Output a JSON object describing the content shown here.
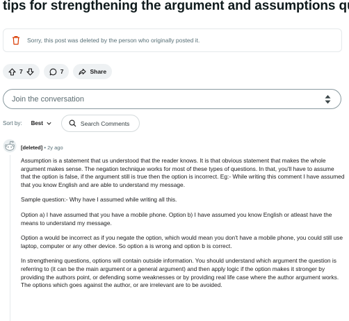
{
  "post": {
    "title": "tips for strengthening the argument and assumptions questions?",
    "deleted_notice": "Sorry, this post was deleted by the person who originally posted it."
  },
  "actions": {
    "vote_count": "7",
    "comment_count": "7",
    "share_label": "Share"
  },
  "composer": {
    "placeholder": "Join the conversation"
  },
  "sort": {
    "label": "Sort by:",
    "value": "Best",
    "search_placeholder": "Search Comments"
  },
  "comment": {
    "author": "[deleted]",
    "separator": "•",
    "age": "2y ago",
    "paragraphs": [
      "Assumption is a statement that us understood that the reader knows. It is that obvious statement that makes the whole argument makes sense. The negation technique works for most of these types of questions. In that, you'll have to assume that the option is false, if the argument still is true then the option is incorrect. Eg:- While writing this comment I have assumed that you know English and are able to understand my message.",
      "Sample question:- Why have I assumed while writing all this.",
      "Option a) I have assumed that you have a mobile phone. Option b) I have assumed you know English or atleast have the means to understand my message.",
      "Option a would be incorrect as if you negate the option, which would mean you don't have a mobile phone, you could still use laptop, computer or any other device. So option a is wrong and option b is correct.",
      "In strengthening questions, options will contain outside information. You should understand which argument the question is referring to (it can be the main argument or a general argument) and then apply logic if the option makes it stronger by providing the authors point, or defending some weaknesses or by providing real life case where the author argument works. The options which goes against the author, or are irrelevant are to be avoided."
    ]
  },
  "colors": {
    "trash_icon": "#d93a00",
    "pill_bg": "#eef1f3",
    "meta_text": "#576f76"
  },
  "icons": {
    "trash": "trash-icon",
    "upvote": "upvote-arrow-icon",
    "downvote": "downvote-arrow-icon",
    "comment": "comment-bubble-icon",
    "share": "share-arrow-icon",
    "stepper_up": "caret-up-icon",
    "stepper_down": "caret-down-icon",
    "sort_chevron": "chevron-down-icon",
    "search": "search-icon",
    "avatar": "snoo-avatar-icon"
  }
}
